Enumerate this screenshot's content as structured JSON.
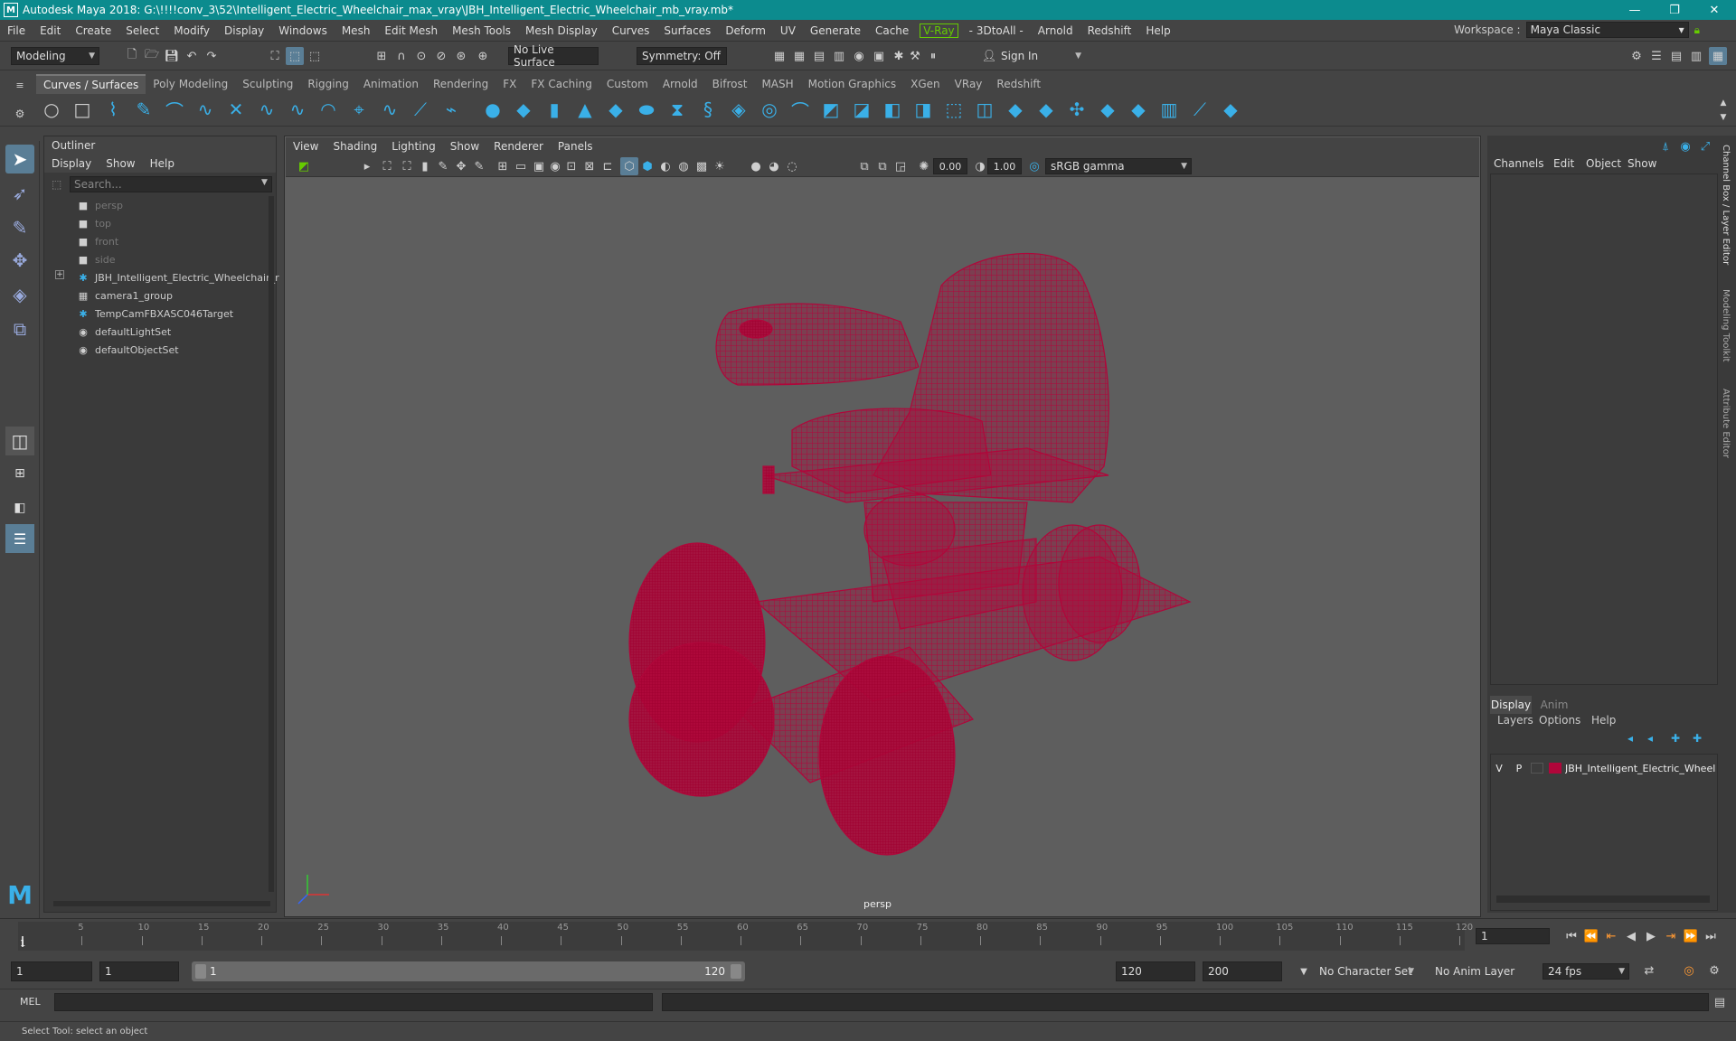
{
  "window": {
    "app_letter": "M",
    "title": "Autodesk Maya 2018: G:\\!!!!conv_3\\52\\Intelligent_Electric_Wheelchair_max_vray\\JBH_Intelligent_Electric_Wheelchair_mb_vray.mb*",
    "minimize": "—",
    "maximize": "❐",
    "close": "✕"
  },
  "menubar": {
    "items": [
      "File",
      "Edit",
      "Create",
      "Select",
      "Modify",
      "Display",
      "Windows",
      "Mesh",
      "Edit Mesh",
      "Mesh Tools",
      "Mesh Display",
      "Curves",
      "Surfaces",
      "Deform",
      "UV",
      "Generate",
      "Cache"
    ],
    "vray": "V-Ray",
    "items2": [
      "- 3DtoAll -",
      "Arnold",
      "Redshift",
      "Help"
    ],
    "workspace_label": "Workspace :",
    "workspace_value": "Maya Classic"
  },
  "statusline": {
    "mode": "Modeling",
    "live_surface": "No Live Surface",
    "symmetry": "Symmetry: Off",
    "sign_in": "Sign In"
  },
  "shelf": {
    "tabs": [
      "Curves / Surfaces",
      "Poly Modeling",
      "Sculpting",
      "Rigging",
      "Animation",
      "Rendering",
      "FX",
      "FX Caching",
      "Custom",
      "Arnold",
      "Bifrost",
      "MASH",
      "Motion Graphics",
      "XGen",
      "VRay",
      "Redshift"
    ],
    "active_tab": 0
  },
  "outliner": {
    "title": "Outliner",
    "menu": [
      "Display",
      "Show",
      "Help"
    ],
    "search_placeholder": "Search...",
    "items": [
      {
        "label": "persp",
        "icon": "camera-icon",
        "dim": true
      },
      {
        "label": "top",
        "icon": "camera-icon",
        "dim": true
      },
      {
        "label": "front",
        "icon": "camera-icon",
        "dim": true
      },
      {
        "label": "side",
        "icon": "camera-icon",
        "dim": true
      },
      {
        "label": "JBH_Intelligent_Electric_Wheelchair_r",
        "icon": "transform-icon",
        "dim": false,
        "expand": "+"
      },
      {
        "label": "camera1_group",
        "icon": "group-icon",
        "dim": false
      },
      {
        "label": "TempCamFBXASC046Target",
        "icon": "transform-icon",
        "dim": false
      },
      {
        "label": "defaultLightSet",
        "icon": "set-icon",
        "dim": false
      },
      {
        "label": "defaultObjectSet",
        "icon": "set-icon",
        "dim": false
      }
    ]
  },
  "viewport": {
    "menu": [
      "View",
      "Shading",
      "Lighting",
      "Show",
      "Renderer",
      "Panels"
    ],
    "exposure": "0.00",
    "gamma": "1.00",
    "color_space": "sRGB gamma",
    "camera_label": "persp",
    "wire_color": "#b0063a"
  },
  "channelbox": {
    "menu": [
      "Channels",
      "Edit",
      "Object",
      "Show"
    ]
  },
  "layereditor": {
    "tabs": [
      "Display",
      "Anim"
    ],
    "menu": [
      "Layers",
      "Options",
      "Help"
    ],
    "layer": {
      "v": "V",
      "p": "P",
      "name": "JBH_Intelligent_Electric_Wheel",
      "color": "#b0063a"
    }
  },
  "sidetabs": [
    "Channel Box / Layer Editor",
    "Modeling Toolkit",
    "Attribute Editor"
  ],
  "timeline": {
    "ticks": [
      "5",
      "10",
      "15",
      "20",
      "25",
      "30",
      "35",
      "40",
      "45",
      "50",
      "55",
      "60",
      "65",
      "70",
      "75",
      "80",
      "85",
      "90",
      "95",
      "100",
      "105",
      "110",
      "115",
      "120"
    ],
    "current_frame_marker": "1",
    "current_frame": "1"
  },
  "range": {
    "start": "1",
    "playback_start": "1",
    "slider_start": "1",
    "slider_end": "120",
    "playback_end": "120",
    "end": "200",
    "character_set": "No Character Set",
    "anim_layer": "No Anim Layer",
    "fps": "24 fps"
  },
  "command": {
    "label": "MEL"
  },
  "helpline": "Select Tool: select an object"
}
